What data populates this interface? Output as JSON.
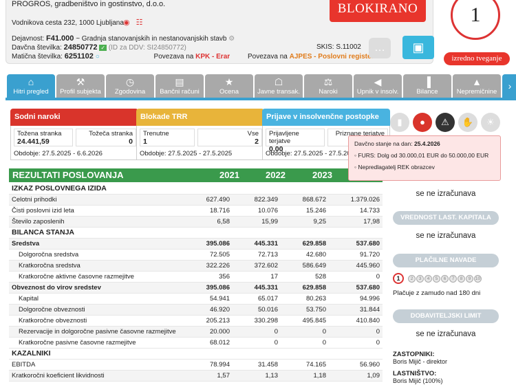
{
  "company": {
    "name": "PROGROS, gradbeništvo in gostinstvo, d.o.o.",
    "address": "Vodnikova cesta 232, 1000 Ljubljana",
    "activity_label": "Dejavnost:",
    "activity_code": "F41.000",
    "activity_text": "~ Gradnja stanovanjskih in nestanovanjskih stavb",
    "tax_label": "Davčna številka:",
    "tax_number": "24850772",
    "vat_text": "(ID za DDV: SI24850772)",
    "reg_label": "Matična številka:",
    "reg_number": "6251102",
    "kpk_prefix": "Povezava na",
    "kpk_link": "KPK - Erar",
    "skis": "SKIS: S.11002",
    "ajpes_prefix": "Povezava na",
    "ajpes_link": "AJPES - Poslovni register",
    "status_banner": "BLOKIRANO",
    "risk_score": "1",
    "risk_label": "izredno tveganje"
  },
  "tabs": [
    {
      "label": "Hitri pregled",
      "icon": "home-icon"
    },
    {
      "label": "Profil subjekta",
      "icon": "factory-icon"
    },
    {
      "label": "Zgodovina",
      "icon": "clock-icon"
    },
    {
      "label": "Bančni računi",
      "icon": "bank-icon"
    },
    {
      "label": "Ocena",
      "icon": "trophy-icon"
    },
    {
      "label": "Javne transak.",
      "icon": "building-icon"
    },
    {
      "label": "Naroki",
      "icon": "scales-icon"
    },
    {
      "label": "Upnik v insolv.",
      "icon": "megaphone-icon"
    },
    {
      "label": "Bilance",
      "icon": "chart-icon"
    },
    {
      "label": "Nepremičnine",
      "icon": "map-icon"
    }
  ],
  "colors": {
    "tab_active": "#3aa0cf",
    "tab_inactive": "#a9a9a9",
    "sodni": "#d9342b",
    "blokade": "#e8b43a",
    "prijave": "#49b3e0",
    "financial_header": "#3a9a4c",
    "alert_red": "#e8352c"
  },
  "boxes": {
    "sodni": {
      "title": "Sodni naroki",
      "col1_label": "Tožena stranka",
      "col1_value": "24.441,59",
      "col2_label": "Tožeča stranka",
      "col2_value": "0",
      "period": "Obdobje: 27.5.2025 - 6.6.2026"
    },
    "blokade": {
      "title": "Blokade TRR",
      "col1_label": "Trenutne",
      "col1_value": "1",
      "col2_label": "Vse",
      "col2_value": "2",
      "period": "Obdobje: 27.5.2025 - 27.5.2025"
    },
    "prijave": {
      "title": "Prijave v insolvenčne postopke",
      "col1_label": "Prijavljene terjatve",
      "col1_value": "0,00",
      "col2_label": "Priznane terjatve",
      "col2_value": "",
      "period": "Obdobje: 27.5.2025 - 27.5.2025"
    }
  },
  "financial": {
    "title": "REZULTATI POSLOVANJA",
    "years": [
      "2021",
      "2022",
      "2023",
      ""
    ],
    "rows": [
      {
        "type": "sec",
        "label": "IZKAZ POSLOVNEGA IZIDA",
        "values": [
          "",
          "",
          "",
          ""
        ]
      },
      {
        "type": "row",
        "label": "Celotni prihodki",
        "values": [
          "627.490",
          "822.349",
          "868.672",
          "1.379.026"
        ]
      },
      {
        "type": "row",
        "label": "Čisti poslovni izid leta",
        "values": [
          "18.716",
          "10.076",
          "15.246",
          "14.733"
        ]
      },
      {
        "type": "row",
        "label": "Število zaposlenih",
        "values": [
          "6,58",
          "15,99",
          "9,25",
          "17,98"
        ]
      },
      {
        "type": "sec",
        "label": "BILANCA STANJA",
        "values": [
          "",
          "",
          "",
          ""
        ]
      },
      {
        "type": "bold",
        "label": "Sredstva",
        "values": [
          "395.086",
          "445.331",
          "629.858",
          "537.680"
        ]
      },
      {
        "type": "ind",
        "label": "Dolgoročna sredstva",
        "values": [
          "72.505",
          "72.713",
          "42.680",
          "91.720"
        ]
      },
      {
        "type": "ind",
        "label": "Kratkoročna sredstva",
        "values": [
          "322.226",
          "372.602",
          "586.649",
          "445.960"
        ]
      },
      {
        "type": "ind",
        "label": "Kratkoročne aktivne časovne razmejitve",
        "values": [
          "356",
          "17",
          "528",
          "0"
        ]
      },
      {
        "type": "bold",
        "label": "Obveznost do virov sredstev",
        "values": [
          "395.086",
          "445.331",
          "629.858",
          "537.680"
        ]
      },
      {
        "type": "ind",
        "label": "Kapital",
        "values": [
          "54.941",
          "65.017",
          "80.263",
          "94.996"
        ]
      },
      {
        "type": "ind",
        "label": "Dolgoročne obveznosti",
        "values": [
          "46.920",
          "50.016",
          "53.750",
          "31.844"
        ]
      },
      {
        "type": "ind",
        "label": "Kratkoročne obveznosti",
        "values": [
          "205.213",
          "330.298",
          "495.845",
          "410.840"
        ]
      },
      {
        "type": "ind",
        "label": "Rezervacije in dolgoročne pasivne časovne razmejitve",
        "values": [
          "20.000",
          "0",
          "0",
          "0"
        ]
      },
      {
        "type": "ind",
        "label": "Kratkoročne pasivne časovne razmejitve",
        "values": [
          "68.012",
          "0",
          "0",
          "0"
        ]
      },
      {
        "type": "sec",
        "label": "KAZALNIKI",
        "values": [
          "",
          "",
          "",
          ""
        ]
      },
      {
        "type": "row",
        "label": "EBITDA",
        "values": [
          "78.994",
          "31.458",
          "74.165",
          "56.960"
        ]
      },
      {
        "type": "row",
        "label": "Kratkoročni koeficient likvidnosti",
        "values": [
          "1,57",
          "1,13",
          "1,18",
          "1,09"
        ]
      }
    ]
  },
  "alert_icons": [
    "trash-icon",
    "money-bag-icon",
    "warning-icon",
    "handshake-icon",
    "island-icon"
  ],
  "popup": {
    "title_prefix": "Davčno stanje na dan:",
    "date": "25.4.2026",
    "items": [
      "FURS: Dolg od 30.000,01 EUR do 50.000,00 EUR",
      "Nepredlagatelj REK obrazcev"
    ]
  },
  "side": {
    "val1": "se ne izračunava",
    "kapital_title": "VREDNOST LAST. KAPITALA",
    "kapital_value": "se ne izračunava",
    "navade_title": "PLAČILNE NAVADE",
    "navade_dots": [
      "1",
      "2",
      "3",
      "4",
      "5",
      "6",
      "7",
      "8",
      "9",
      "10"
    ],
    "navade_text": "Plačuje z zamudo nad 180 dni",
    "limit_title": "DOBAVITELJSKI LIMIT",
    "limit_value": "se ne izračunava",
    "zastopniki_label": "ZASTOPNIKI:",
    "zastopniki_value": "Boris Mijič - direktor",
    "lastnistvo_label": "LASTNIŠTVO:",
    "lastnistvo_value": "Boris Mijič (100%)"
  }
}
